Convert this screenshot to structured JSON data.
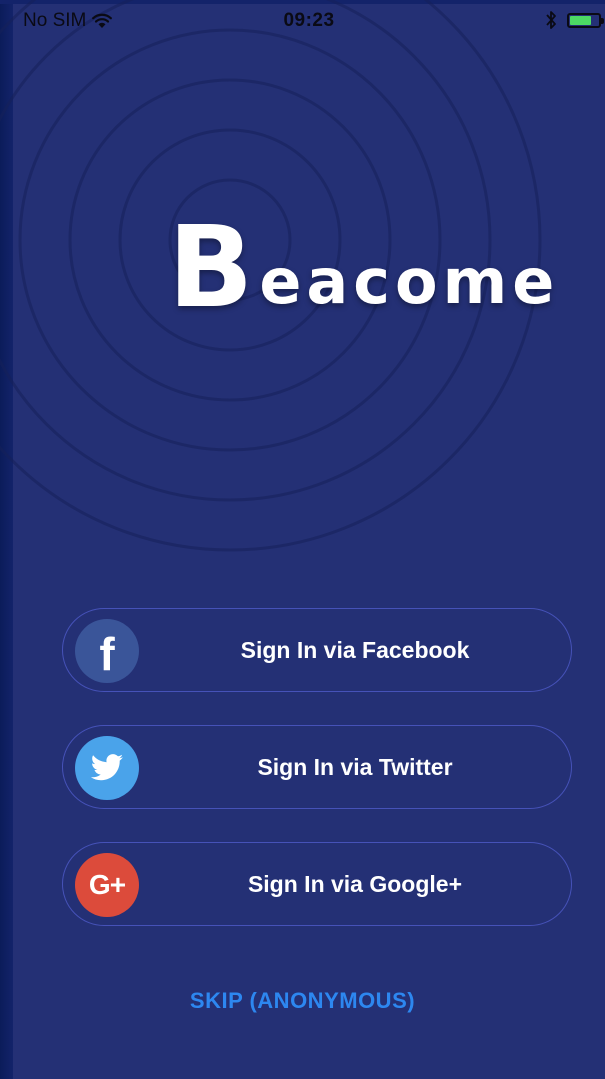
{
  "status_bar": {
    "carrier": "No SIM",
    "time": "09:23",
    "battery_level": 0.75,
    "battery_color": "#4cd964"
  },
  "logo": {
    "initial": "B",
    "rest": "eacome"
  },
  "buttons": {
    "facebook": {
      "label": "Sign In via Facebook",
      "icon": "facebook-icon",
      "color": "#3a5599"
    },
    "twitter": {
      "label": "Sign In via Twitter",
      "icon": "twitter-icon",
      "color": "#4aa3ea"
    },
    "google": {
      "label": "Sign In via Google+",
      "icon": "google-plus-icon",
      "glyph": "G+",
      "color": "#dc4b3b"
    }
  },
  "skip": {
    "label": "SKIP (ANONYMOUS)",
    "color": "#2d87f0"
  },
  "colors": {
    "background": "#243075",
    "button_border": "#4652b8"
  }
}
